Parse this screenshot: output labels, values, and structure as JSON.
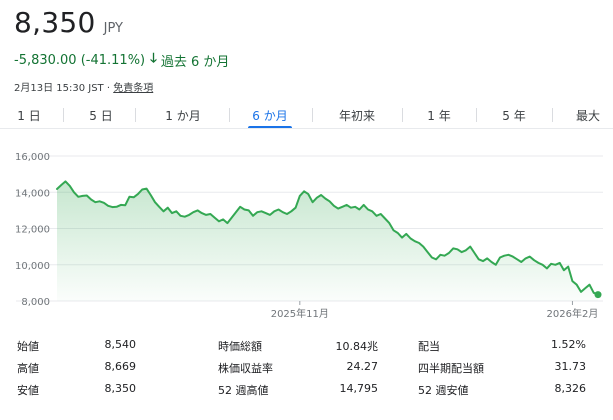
{
  "quote": {
    "price": "8,350",
    "currency": "JPY",
    "change": "-5,830.00 (-41.11%)",
    "period": "過去 6 か月",
    "timestamp": "2月13日 15:30 JST",
    "separator": "·",
    "disclaimer": "免責条項",
    "up_color": "#137333",
    "line_color": "#34a853",
    "accent_color": "#1a73e8"
  },
  "tabs": [
    {
      "label": "1 日",
      "active": false
    },
    {
      "label": "5 日",
      "active": false
    },
    {
      "label": "1 か月",
      "active": false
    },
    {
      "label": "6 か月",
      "active": true
    },
    {
      "label": "年初来",
      "active": false
    },
    {
      "label": "1 年",
      "active": false
    },
    {
      "label": "5 年",
      "active": false
    },
    {
      "label": "最大",
      "active": false
    }
  ],
  "chart_data": {
    "type": "area",
    "title": "",
    "xlabel": "",
    "ylabel": "",
    "ylim": [
      8000,
      16000
    ],
    "yticks": [
      "16,000",
      "14,000",
      "12,000",
      "10,000",
      "8,000"
    ],
    "ytick_values": [
      16000,
      14000,
      12000,
      10000,
      8000
    ],
    "xtick_labels": [
      "2025年11月",
      "2026年2月"
    ],
    "xtick_index": [
      57,
      121
    ],
    "grid": true,
    "series": [
      {
        "values": [
          14180,
          14400,
          14600,
          14350,
          14000,
          13750,
          13800,
          13820,
          13600,
          13450,
          13500,
          13420,
          13250,
          13180,
          13200,
          13300,
          13280,
          13750,
          13720,
          13900,
          14150,
          14200,
          13850,
          13450,
          13200,
          12950,
          13150,
          12850,
          12950,
          12700,
          12650,
          12750,
          12900,
          13000,
          12850,
          12750,
          12800,
          12600,
          12400,
          12500,
          12300,
          12600,
          12900,
          13200,
          13050,
          13000,
          12700,
          12900,
          12950,
          12850,
          12750,
          12950,
          13050,
          12900,
          12800,
          12950,
          13150,
          13800,
          14050,
          13900,
          13450,
          13700,
          13850,
          13650,
          13500,
          13250,
          13100,
          13200,
          13300,
          13150,
          13200,
          13050,
          13300,
          13050,
          12950,
          12700,
          12800,
          12550,
          12300,
          11900,
          11750,
          11500,
          11700,
          11450,
          11300,
          11200,
          11000,
          10700,
          10400,
          10300,
          10550,
          10500,
          10650,
          10900,
          10850,
          10700,
          10800,
          11000,
          10650,
          10300,
          10200,
          10350,
          10150,
          10000,
          10400,
          10500,
          10550,
          10450,
          10300,
          10150,
          10350,
          10450,
          10250,
          10100,
          10000,
          9800,
          10050,
          10000,
          10100,
          9700,
          9900,
          9100,
          8900,
          8500,
          8700,
          8900,
          8450,
          8350
        ]
      }
    ]
  },
  "stats": [
    [
      {
        "label": "始値",
        "value": "8,540"
      },
      {
        "label": "時価総額",
        "value": "10.84兆"
      },
      {
        "label": "配当",
        "value": "1.52%"
      }
    ],
    [
      {
        "label": "高値",
        "value": "8,669"
      },
      {
        "label": "株価収益率",
        "value": "24.27"
      },
      {
        "label": "四半期配当額",
        "value": "31.73"
      }
    ],
    [
      {
        "label": "安値",
        "value": "8,350"
      },
      {
        "label": "52 週高値",
        "value": "14,795"
      },
      {
        "label": "52 週安値",
        "value": "8,326"
      }
    ]
  ]
}
